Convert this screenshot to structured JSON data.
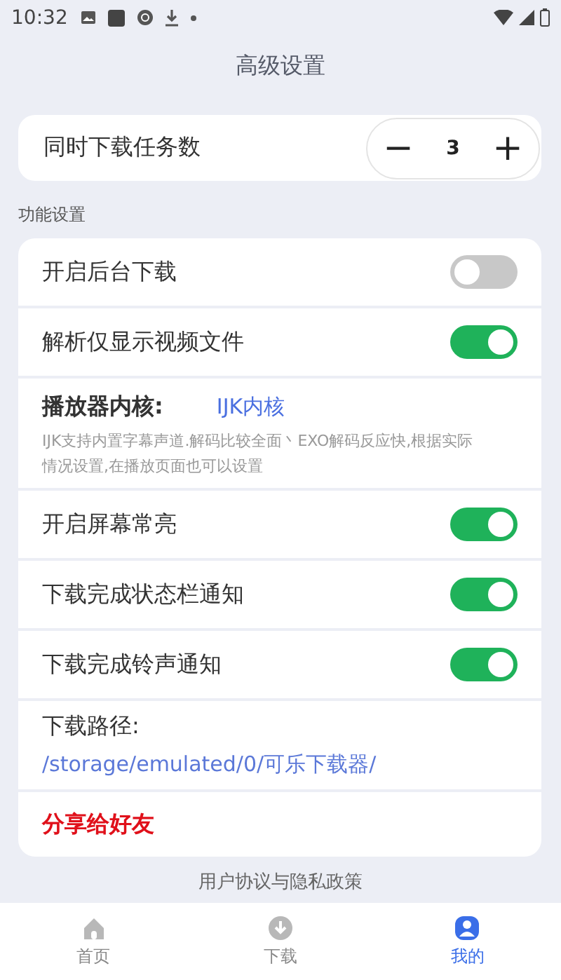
{
  "status_bar": {
    "time": "10:32"
  },
  "title": "高级设置",
  "task_count": {
    "label": "同时下载任务数",
    "minus": "−",
    "value": "3",
    "plus": "+"
  },
  "section_title": "功能设置",
  "settings": [
    {
      "kind": "toggle",
      "label": "开启后台下载",
      "on": false
    },
    {
      "kind": "toggle",
      "label": "解析仅显示视频文件",
      "on": true
    },
    {
      "kind": "choice",
      "label": "播放器内核:",
      "value": "IJK内核",
      "description": "IJK支持内置字幕声道.解码比较全面丶EXO解码反应快,根据实际情况设置,在播放页面也可以设置"
    },
    {
      "kind": "toggle",
      "label": "开启屏幕常亮",
      "on": true
    },
    {
      "kind": "toggle",
      "label": "下载完成状态栏通知",
      "on": true
    },
    {
      "kind": "toggle",
      "label": "下载完成铃声通知",
      "on": true
    },
    {
      "kind": "path",
      "label": "下载路径:",
      "value": "/storage/emulated/0/可乐下载器/"
    },
    {
      "kind": "action",
      "label": "分享给好友"
    }
  ],
  "footer_link": "用户协议与隐私政策",
  "nav": [
    {
      "kind": "home",
      "label": "首页",
      "selected": false
    },
    {
      "kind": "download",
      "label": "下载",
      "selected": false
    },
    {
      "kind": "person",
      "label": "我的",
      "selected": true
    }
  ]
}
